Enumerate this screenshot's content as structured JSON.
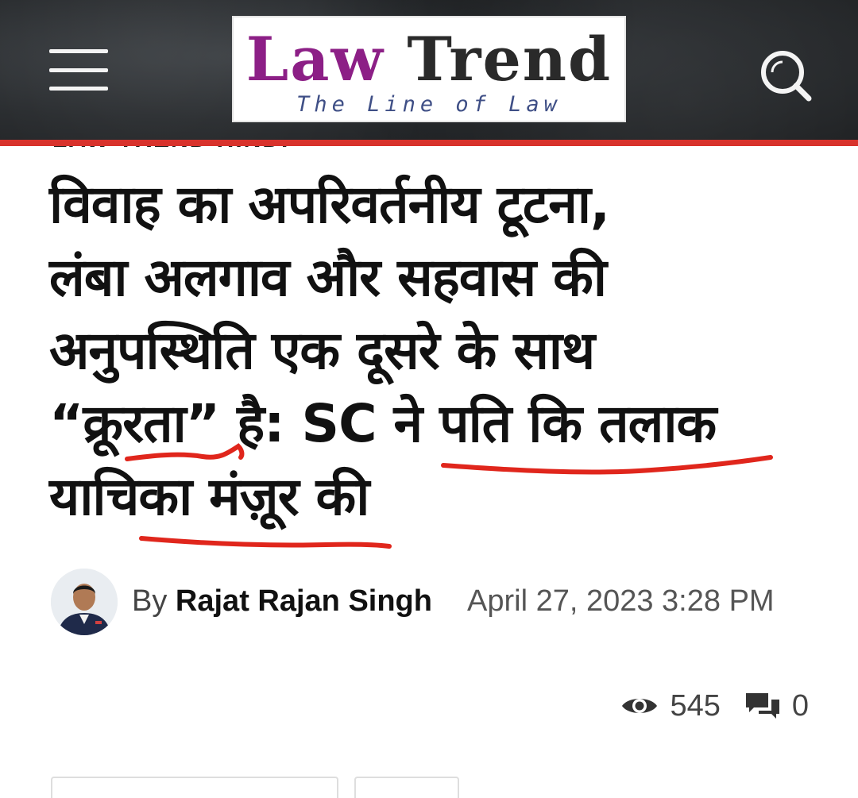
{
  "header": {
    "logo_word_1": "Law",
    "logo_word_2": "Trend",
    "logo_tagline": "The Line of Law",
    "accent_color": "#d8322c",
    "logo_primary_color": "#8c1f86",
    "menu_icon": "hamburger-menu-icon",
    "search_icon": "search-icon"
  },
  "article": {
    "category": "LAW TREND HINDI",
    "headline_lines": [
      "विवाह का अपरिवर्तनीय टूटना,",
      "लंबा अलगाव और सहवास की",
      "अनुपस्थिति एक दूसरे के साथ",
      "“क्रूरता” है: SC ने पति कि तलाक",
      "याचिका मंज़ूर की"
    ],
    "byline_prefix": "By",
    "author": "Rajat Rajan Singh",
    "date": "April 27, 2023 3:28 PM",
    "annotation_color": "#e0261c"
  },
  "stats": {
    "views_icon": "eye-icon",
    "views": "545",
    "comments_icon": "comment-icon",
    "comments": "0"
  }
}
